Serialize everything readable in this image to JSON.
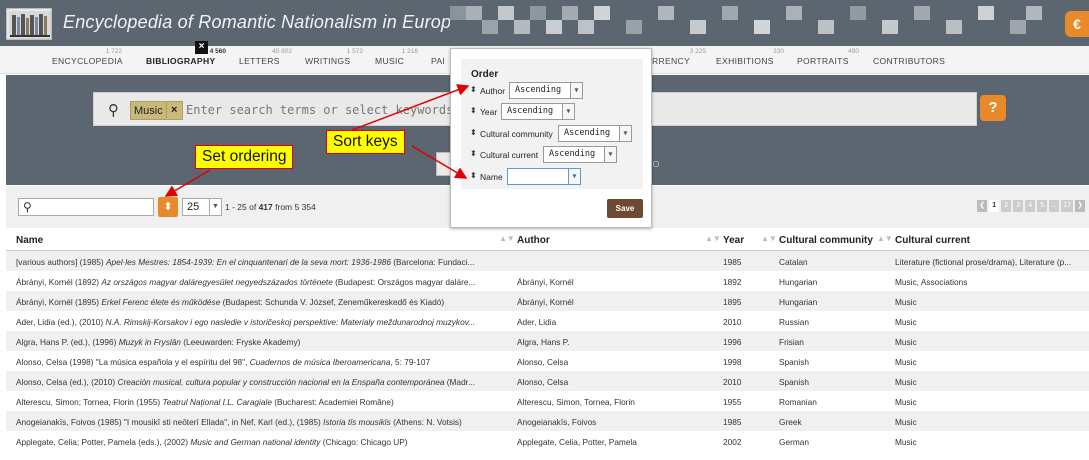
{
  "header": {
    "site_title": "Encyclopedia of Romantic Nationalism in Europe",
    "logo_icon": "book-shelf-icon",
    "corner_button_label": "€"
  },
  "nav": {
    "items": [
      {
        "label": "Encyclopedia",
        "count": "1 722",
        "active": false
      },
      {
        "label": "Bibliography",
        "count": "4 560",
        "active": true
      },
      {
        "label": "Letters",
        "count": "45 802",
        "active": false
      },
      {
        "label": "Writings",
        "count": "1 572",
        "active": false
      },
      {
        "label": "Music",
        "count": "1 216",
        "active": false
      },
      {
        "label": "Pai",
        "count": "",
        "active": false
      },
      {
        "label": "rrency",
        "count": "3 225",
        "active": false
      },
      {
        "label": "Exhibitions",
        "count": "330",
        "active": false
      },
      {
        "label": "Portraits",
        "count": "490",
        "active": false
      },
      {
        "label": "Contributors",
        "count": "",
        "active": false
      }
    ]
  },
  "search": {
    "chip_label": "Music",
    "chip_remove": "×",
    "placeholder": "Enter search terms or select keywords to",
    "help_label": "?"
  },
  "toolbar": {
    "page_size": "25",
    "range_prefix": "1 - 25 of",
    "range_total": "417",
    "range_suffix": "from 5 354",
    "pages": [
      "1",
      "2",
      "3",
      "4",
      "5",
      "...",
      "17"
    ]
  },
  "table": {
    "columns": [
      "Name",
      "Author",
      "Year",
      "Cultural community",
      "Cultural current"
    ],
    "rows": [
      {
        "name_pre": "[various authors] (1985) ",
        "name_it": "Apel·les Mestres: 1854-1939: En el cinquantenari de la seva mort: 1936-1986",
        "name_post": " (Barcelona: Fundaci...",
        "author": "",
        "year": "1985",
        "community": "Catalan",
        "current": "Literature (fictional prose/drama), Literature (p..."
      },
      {
        "name_pre": "Ábrányi, Kornél (1892) ",
        "name_it": "Az országos magyar daláregyesület negyedszázados története",
        "name_post": " (Budapest: Országos magyar daláre...",
        "author": "Ábrányi, Kornél",
        "year": "1892",
        "community": "Hungarian",
        "current": "Music, Associations"
      },
      {
        "name_pre": "Ábrányi, Kornél (1895) ",
        "name_it": "Erkel Ferenc élete és működése",
        "name_post": " (Budapest: Schunda V. József, Zeneműkereskedő és Kiadó)",
        "author": "Ábrányi, Kornél",
        "year": "1895",
        "community": "Hungarian",
        "current": "Music"
      },
      {
        "name_pre": "Ader, Lidia (ed.), (2010) ",
        "name_it": "N.A. Rimskij-Korsakov i ego nasledie v istoričeskoj perspektive: Materialy meždunarodnoj muzykov...",
        "name_post": "",
        "author": "Ader, Lidia",
        "year": "2010",
        "community": "Russian",
        "current": "Music"
      },
      {
        "name_pre": "Algra, Hans P. (ed.), (1996) ",
        "name_it": "Muzyk in Fryslân",
        "name_post": " (Leeuwarden: Fryske Akademy)",
        "author": "Algra, Hans P.",
        "year": "1996",
        "community": "Frisian",
        "current": "Music"
      },
      {
        "name_pre": "Alonso, Celsa (1998) \"La música española y el espíritu del 98\", ",
        "name_it": "Cuadernos de música Iberoamericana",
        "name_post": ", 5: 79-107",
        "author": "Alonso, Celsa",
        "year": "1998",
        "community": "Spanish",
        "current": "Music"
      },
      {
        "name_pre": "Alonso, Celsa (ed.), (2010) ",
        "name_it": "Creación musical, cultura popular y construcción nacional en la Enspaña contemporánea",
        "name_post": " (Madr...",
        "author": "Alonso, Celsa",
        "year": "2010",
        "community": "Spanish",
        "current": "Music"
      },
      {
        "name_pre": "Alterescu, Simon; Tornea, Florin (1955) ",
        "name_it": "Teatrul Naţional I.L. Caragiale",
        "name_post": " (Bucharest: Academiei Române)",
        "author": "Alterescu, Simon, Tornea, Florin",
        "year": "1955",
        "community": "Romanian",
        "current": "Music"
      },
      {
        "name_pre": "Anogeianakīs, Foivos (1985) \"I mousikī sti neōterī Ellada\", in Nef, Karl (ed.), (1985) ",
        "name_it": "Istoria tīs mousikīs",
        "name_post": " (Athens: N. Votsis)",
        "author": "Anogeianakīs, Foivos",
        "year": "1985",
        "community": "Greek",
        "current": "Music"
      },
      {
        "name_pre": "Applegate, Celia; Potter, Pamela (eds.), (2002) ",
        "name_it": "Music and German national identity",
        "name_post": " (Chicago: Chicago UP)",
        "author": "Applegate, Celia, Potter, Pamela",
        "year": "2002",
        "community": "German",
        "current": "Music"
      }
    ]
  },
  "order_dialog": {
    "close_label": "×",
    "title": "Order",
    "keys": [
      {
        "label": "Author",
        "value": "Ascending"
      },
      {
        "label": "Year",
        "value": "Ascending"
      },
      {
        "label": "Cultural community",
        "value": "Ascending"
      },
      {
        "label": "Cultural current",
        "value": "Ascending"
      },
      {
        "label": "Name",
        "value": ""
      }
    ],
    "save_label": "Save"
  },
  "annotations": {
    "sort_keys": "Sort keys",
    "set_ordering": "Set ordering",
    "callout_color": "#ffff00",
    "arrow_color": "#e00000"
  },
  "colors": {
    "header_bg": "#5b6670",
    "accent_orange": "#e88a2a",
    "save_button": "#6e4a32"
  }
}
